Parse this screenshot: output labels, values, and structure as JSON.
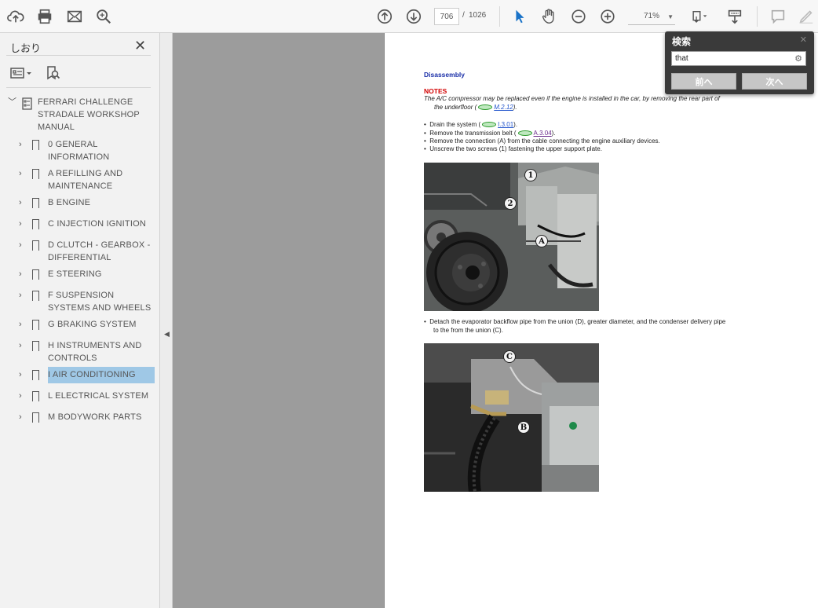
{
  "toolbar": {
    "page_current": "706",
    "page_separator": "/",
    "page_total": "1026",
    "zoom": "71%"
  },
  "sidebar": {
    "title": "しおり",
    "close": "✕",
    "root": "FERRARI CHALLENGE STRADALE WORKSHOP MANUAL",
    "items": [
      {
        "label": "0 GENERAL INFORMATION"
      },
      {
        "label": "A REFILLING AND MAINTENANCE"
      },
      {
        "label": "B ENGINE"
      },
      {
        "label": "C INJECTION IGNITION"
      },
      {
        "label": "D CLUTCH - GEARBOX - DIFFERENTIAL"
      },
      {
        "label": "E STEERING"
      },
      {
        "label": "F SUSPENSION SYSTEMS AND WHEELS"
      },
      {
        "label": "G BRAKING SYSTEM"
      },
      {
        "label": "H INSTRUMENTS AND CONTROLS"
      },
      {
        "label": "I AIR CONDITIONING"
      },
      {
        "label": "L ELECTRICAL SYSTEM"
      },
      {
        "label": "M BODYWORK PARTS"
      }
    ],
    "selected_index": 9
  },
  "document": {
    "heading": "Disassembly",
    "notes_title": "NOTES",
    "notes_text_1": "The A/C compressor may be replaced even if the engine is installed in the car, by removing the rear part of",
    "notes_text_2": "the underfloor (",
    "notes_link": "M.2.12",
    "notes_close": ").",
    "bullets": [
      {
        "text": "Drain the system (",
        "link": "I.3.01",
        "tail": ")."
      },
      {
        "text": "Remove the transmission belt (",
        "link": "A.3.04",
        "tail": ")."
      },
      {
        "text": "Remove the connection (A) from the cable connecting the engine auxiliary devices.",
        "link": "",
        "tail": ""
      },
      {
        "text": "Unscrew the two screws (1) fastening the upper support plate.",
        "link": "",
        "tail": ""
      }
    ],
    "bullet2_line1": "Detach the evaporator backflow pipe from the union (D), greater diameter, and the condenser delivery pipe",
    "bullet2_line2": "to the from the union (C).",
    "photo1_callouts": [
      "1",
      "2",
      "A"
    ],
    "photo2_callouts": [
      "C",
      "B"
    ]
  },
  "find": {
    "title": "検索",
    "close": "✕",
    "value": "that",
    "prev_label": "前へ",
    "next_label": "次へ"
  }
}
